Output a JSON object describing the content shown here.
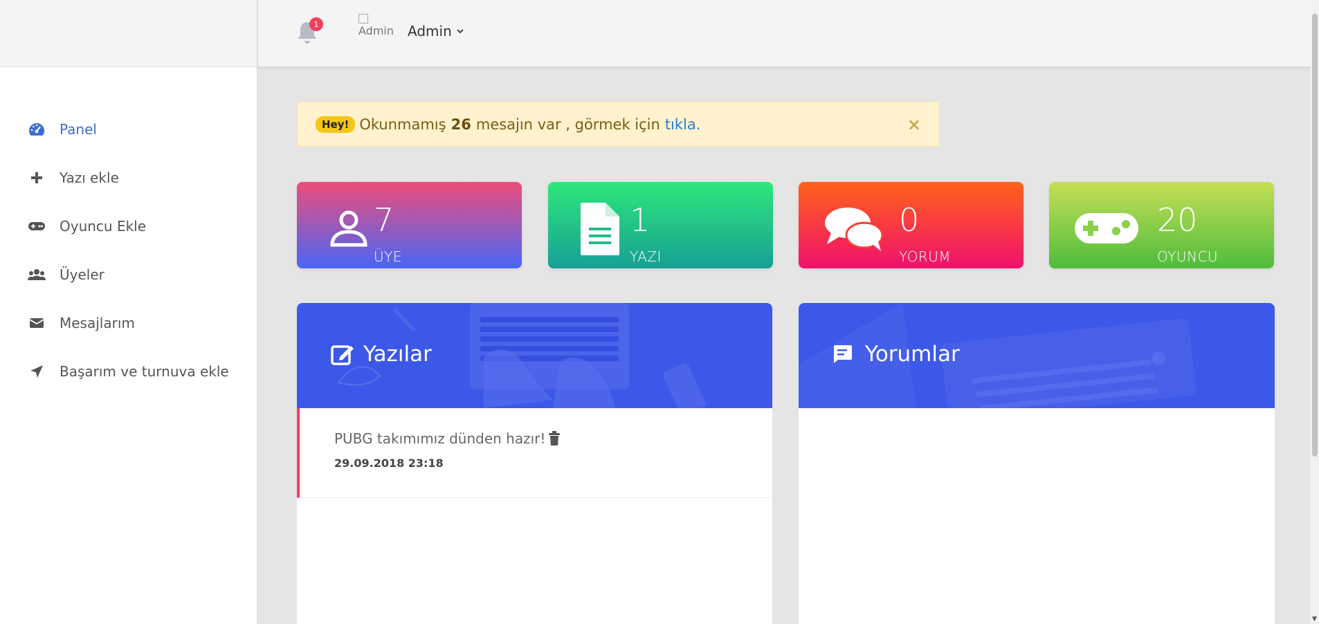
{
  "header": {
    "notification_count": "1",
    "avatar_alt": "Admin",
    "user_name": "Admin"
  },
  "sidebar": {
    "items": [
      {
        "label": "Panel",
        "icon": "dashboard-icon",
        "active": true
      },
      {
        "label": "Yazı ekle",
        "icon": "plus-icon"
      },
      {
        "label": "Oyuncu Ekle",
        "icon": "gamepad-icon"
      },
      {
        "label": "Üyeler",
        "icon": "users-icon"
      },
      {
        "label": "Mesajlarım",
        "icon": "envelope-icon"
      },
      {
        "label": "Başarım ve turnuva ekle",
        "icon": "paper-plane-icon"
      }
    ]
  },
  "alert": {
    "badge": "Hey!",
    "text_before": "Okunmamış",
    "count": "26",
    "text_after": "mesajın var , görmek için",
    "link": "tıkla.",
    "close": "×"
  },
  "stats": [
    {
      "value": "7",
      "label": "ÜYE",
      "icon": "user-icon",
      "color": "#ee4d79"
    },
    {
      "value": "1",
      "label": "YAZI",
      "icon": "file-icon",
      "color": "#2ee77b"
    },
    {
      "value": "0",
      "label": "YORUM",
      "icon": "comments-icon",
      "color": "#fe6318"
    },
    {
      "value": "20",
      "label": "OYUNCU",
      "icon": "gamepad-icon",
      "color": "#c5e056"
    }
  ],
  "panels": {
    "posts": {
      "title": "Yazılar",
      "items": [
        {
          "title": "PUBG takımımız dünden hazır!",
          "date": "29.09.2018 23:18"
        }
      ]
    },
    "comments": {
      "title": "Yorumlar"
    }
  },
  "colors": {
    "accent": "#3d6ed1",
    "panel_header": "#3c58e8",
    "post_border": "#f0405f"
  }
}
